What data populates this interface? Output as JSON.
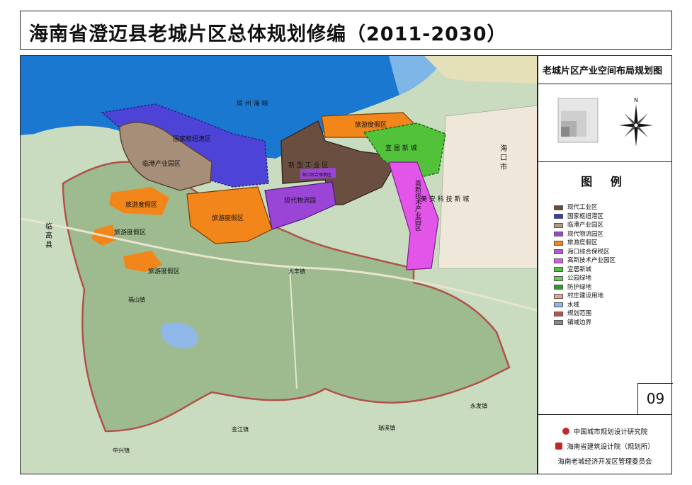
{
  "title": "海南省澄迈县老城片区总体规划修编（2011-2030）",
  "panel": {
    "map_title": "老城片区产业空间布局规划图",
    "north_label": "N",
    "legend_heading": "图  例",
    "page_number": "09"
  },
  "legend": [
    {
      "label": "现代工业区",
      "color": "#6b4a3a"
    },
    {
      "label": "国家枢纽港区",
      "color": "#3d35c9"
    },
    {
      "label": "临港产业园区",
      "color": "#b89a86"
    },
    {
      "label": "现代物流园区",
      "color": "#9a45d6"
    },
    {
      "label": "旅游度假区",
      "color": "#f2861a"
    },
    {
      "label": "海口综合保税区",
      "color": "#b35ad0"
    },
    {
      "label": "高新技术产业园区",
      "color": "#e255e8"
    },
    {
      "label": "宜居新城",
      "color": "#52c23a"
    },
    {
      "label": "公园绿地",
      "color": "#63d552"
    },
    {
      "label": "防护绿地",
      "color": "#2e9a2a"
    },
    {
      "label": "村庄建设用地",
      "color": "#f0a08c"
    },
    {
      "label": "水域",
      "color": "#8fb8e8"
    },
    {
      "label": "规划范围",
      "color": "#c0504d"
    },
    {
      "label": "镇域边界",
      "color": "#888888"
    }
  ],
  "map_labels": {
    "strait": "琼 州 海 峡",
    "hub_port": "国家枢纽港区",
    "lingang": "临港产业园区",
    "industry": "新 型 工 业 区",
    "bonded": "海口综合保税区",
    "resort_north": "旅游度假区",
    "livable": "宜 居 新 城",
    "logistics": "现代物流园",
    "resort_center": "旅游度假区",
    "resort_west1": "旅游度假区",
    "resort_west2": "旅游度假区",
    "resort_west3": "旅游度假区",
    "hightech": "高新技术产业园区",
    "tech_city": "美 安 科 技 新 城",
    "haikou": "海 口 市",
    "lingao": "临 高 县",
    "dafeng": "大丰镇",
    "fushan": "福山镇",
    "jinjiang": "金江镇",
    "ruixi": "瑞溪镇",
    "yongfa": "永发镇",
    "zhongxing": "中兴镇"
  },
  "credits": [
    {
      "text": "中国城市规划设计研究院",
      "color": "#c0282d"
    },
    {
      "text": "海南省建筑设计院（规划所）",
      "color": "#c0282d"
    },
    {
      "text": "海南老城经济开发区管理委员会",
      "color": ""
    }
  ]
}
